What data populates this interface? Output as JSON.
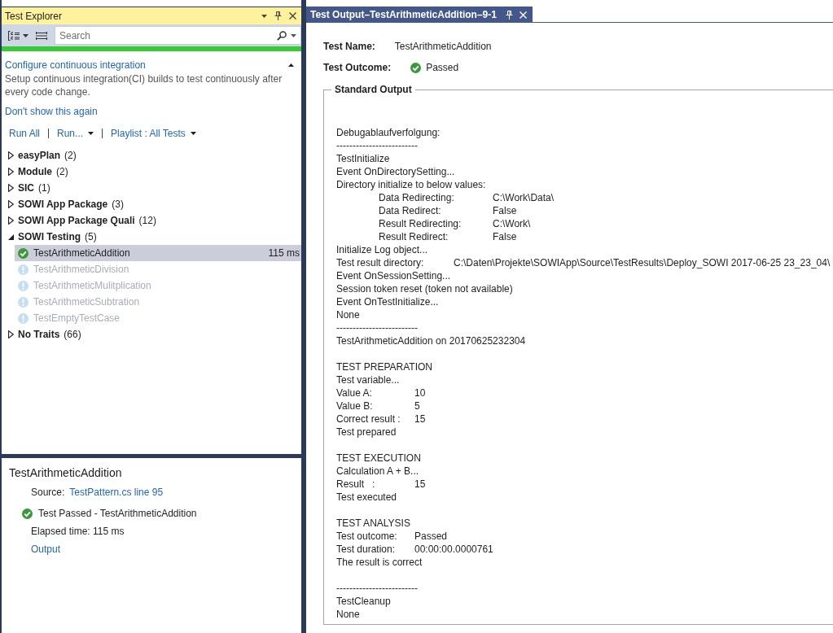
{
  "test_explorer": {
    "title": "Test Explorer",
    "search": {
      "placeholder": "Search"
    },
    "result_bar": {
      "passed": true
    },
    "banner": {
      "title": "Configure continuous integration",
      "text": "Setup continuous integration(CI) builds to test continuously after every code change.",
      "dismiss": "Don't show this again"
    },
    "toolbar": [
      {
        "label": "Run All",
        "dropdown": false
      },
      {
        "label": "Run...",
        "dropdown": true
      },
      {
        "label": "Playlist : All Tests",
        "dropdown": true
      }
    ],
    "tree": [
      {
        "name": "easyPlan",
        "count": "(2)",
        "expanded": false
      },
      {
        "name": "Module",
        "count": "(2)",
        "expanded": false
      },
      {
        "name": "SIC",
        "count": "(1)",
        "expanded": false
      },
      {
        "name": "SOWI App Package",
        "count": "(3)",
        "expanded": false
      },
      {
        "name": "SOWI App Package Quali",
        "count": "(12)",
        "expanded": false
      },
      {
        "name": "SOWI Testing",
        "count": "(5)",
        "expanded": true,
        "children": [
          {
            "name": "TestArithmeticAddition",
            "passed": true,
            "duration": "115 ms",
            "selected": true
          },
          {
            "name": "TestArithmeticDivision",
            "passed": false,
            "selected": false
          },
          {
            "name": "TestArithmeticMulitplication",
            "passed": false,
            "selected": false
          },
          {
            "name": "TestArithmeticSubtration",
            "passed": false,
            "selected": false
          },
          {
            "name": "TestEmptyTestCase",
            "passed": false,
            "selected": false
          }
        ]
      },
      {
        "name": "No Traits",
        "count": "(66)",
        "expanded": false
      }
    ],
    "details": {
      "title": "TestArithmeticAddition",
      "source_label": "Source:",
      "source_link": "TestPattern.cs line 95",
      "passed": true,
      "result": "Test Passed - TestArithmeticAddition",
      "elapsed": "Elapsed time: 115 ms",
      "output_link": "Output"
    }
  },
  "document": {
    "tab_title": "Test Output–TestArithmeticAddition–9-1",
    "fields": [
      {
        "label": "Test Name:",
        "value": "TestArithmeticAddition"
      },
      {
        "label": "Test Outcome:",
        "value": "Passed",
        "passed": true
      }
    ],
    "standard_output": {
      "legend": "Standard Output",
      "blocks": [
        {
          "lines": [
            {
              "kind": "text",
              "text": "Debugablaufverfolgung:"
            },
            {
              "kind": "text",
              "text": "-------------------------"
            },
            {
              "kind": "text",
              "text": "TestInitialize"
            },
            {
              "kind": "text",
              "text": "Event OnDirectorySetting..."
            },
            {
              "kind": "text",
              "text": "Directory initialize to below values:"
            },
            {
              "kind": "subpair",
              "label": "Data Redirecting:",
              "value": "C:\\Work\\Data\\"
            },
            {
              "kind": "subpair",
              "label": "Data Redirect:",
              "value": "False"
            },
            {
              "kind": "subpair",
              "label": "Result Redirecting:",
              "value": "C:\\Work\\"
            },
            {
              "kind": "subpair",
              "label": "Result Redirect:",
              "value": "False"
            },
            {
              "kind": "text",
              "text": "Initialize Log object..."
            },
            {
              "kind": "widepair",
              "label": "Test result directory:",
              "value": "C:\\Daten\\Projekte\\SOWIApp\\Source\\TestResults\\Deploy_SOWI 2017-06-25 23_23_04\\"
            },
            {
              "kind": "text",
              "text": "Event OnSessionSetting..."
            },
            {
              "kind": "text",
              "text": "Session token reset (token not available)"
            },
            {
              "kind": "text",
              "text": "Event OnTestInitialize..."
            },
            {
              "kind": "text",
              "text": "None"
            },
            {
              "kind": "text",
              "text": "-------------------------"
            },
            {
              "kind": "text",
              "text": "TestArithmeticAddition on 20170625232304"
            }
          ]
        },
        {
          "lines": [
            {
              "kind": "text",
              "text": "TEST PREPARATION"
            },
            {
              "kind": "text",
              "text": "Test variable..."
            },
            {
              "kind": "pair",
              "label": "Value A:",
              "value": "10"
            },
            {
              "kind": "pair",
              "label": "Value B:",
              "value": "5"
            },
            {
              "kind": "pair",
              "label": "Correct result :",
              "value": "15"
            },
            {
              "kind": "text",
              "text": "Test prepared"
            }
          ]
        },
        {
          "lines": [
            {
              "kind": "text",
              "text": "TEST EXECUTION"
            },
            {
              "kind": "text",
              "text": "Calculation A + B..."
            },
            {
              "kind": "pair",
              "label": "Result   :",
              "value": "15"
            },
            {
              "kind": "text",
              "text": "Test executed"
            }
          ]
        },
        {
          "lines": [
            {
              "kind": "text",
              "text": "TEST ANALYSIS"
            },
            {
              "kind": "pair",
              "label": "Test outcome:",
              "value": "Passed"
            },
            {
              "kind": "pair",
              "label": "Test duration:",
              "value": "00:00:00.0000761"
            },
            {
              "kind": "text",
              "text": "The result is correct"
            }
          ]
        },
        {
          "lines": [
            {
              "kind": "text",
              "text": "-------------------------"
            },
            {
              "kind": "text",
              "text": "TestCleanup"
            },
            {
              "kind": "text",
              "text": "None"
            }
          ]
        }
      ]
    }
  }
}
